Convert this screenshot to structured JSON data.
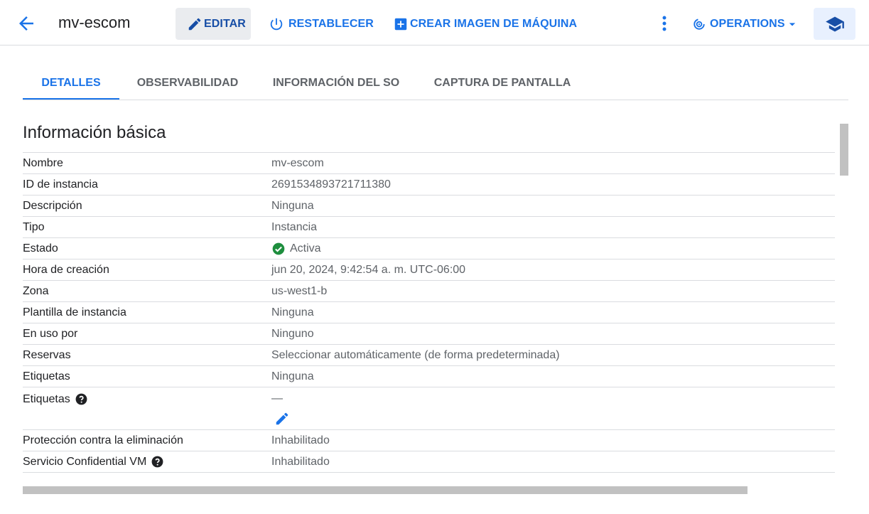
{
  "header": {
    "title": "mv-escom",
    "edit_label": "EDITAR",
    "reset_label": "RESTABLECER",
    "create_image_label": "CREAR IMAGEN DE MÁQUINA",
    "operations_label": "OPERATIONS",
    "icons": [
      "back-arrow-icon",
      "pencil-icon",
      "power-icon",
      "add-box-icon",
      "more-vert-icon",
      "operations-icon",
      "dropdown-caret-icon",
      "school-hat-icon"
    ]
  },
  "tabs": [
    {
      "label": "DETALLES",
      "active": true
    },
    {
      "label": "OBSERVABILIDAD",
      "active": false
    },
    {
      "label": "INFORMACIÓN DEL SO",
      "active": false
    },
    {
      "label": "CAPTURA DE PANTALLA",
      "active": false
    }
  ],
  "section": {
    "title": "Información básica",
    "rows": [
      {
        "key": "Nombre",
        "value": "mv-escom"
      },
      {
        "key": "ID de instancia",
        "value": "2691534893721711380"
      },
      {
        "key": "Descripción",
        "value": "Ninguna"
      },
      {
        "key": "Tipo",
        "value": "Instancia"
      },
      {
        "key": "Estado",
        "value": "Activa"
      },
      {
        "key": "Hora de creación",
        "value": "jun 20, 2024, 9:42:54 a. m. UTC-06:00"
      },
      {
        "key": "Zona",
        "value": "us-west1-b"
      },
      {
        "key": "Plantilla de instancia",
        "value": "Ninguna"
      },
      {
        "key": "En uso por",
        "value": "Ninguno"
      },
      {
        "key": "Reservas",
        "value": "Seleccionar automáticamente (de forma predeterminada)"
      },
      {
        "key": "Etiquetas",
        "value": "Ninguna"
      },
      {
        "key": "Etiquetas",
        "value": "—"
      },
      {
        "key": "Protección contra la eliminación",
        "value": "Inhabilitado"
      },
      {
        "key": "Servicio Confidential VM",
        "value": "Inhabilitado"
      }
    ]
  },
  "colors": {
    "accent": "#1a73e8",
    "status_ok": "#1e8e3e",
    "divider": "#dadce0",
    "muted_text": "#5f6368"
  }
}
